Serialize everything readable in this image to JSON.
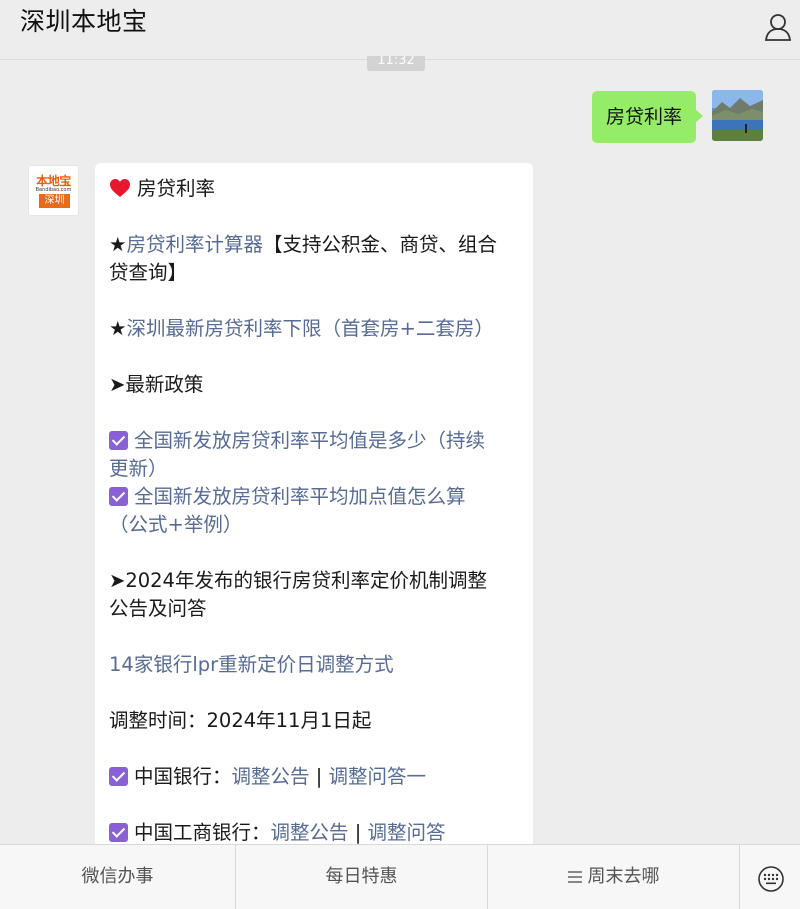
{
  "header": {
    "title": "深圳本地宝"
  },
  "time_label": "11:32",
  "user_message": {
    "text": "房贷利率"
  },
  "bot_avatar": {
    "logo_text": "本地宝",
    "logo_small": "Bendibao.com",
    "logo_box": "深圳"
  },
  "bot_message": {
    "heading": "房贷利率",
    "line1_prefix": "★",
    "line1_link": "房贷利率计算器",
    "line1_suffix": "【支持公积金、商贷、组合",
    "line1_cont": "贷查询】",
    "line2_prefix": "★",
    "line2_link": "深圳最新房贷利率下限（首套房+二套房）",
    "policy_heading": "➤最新政策",
    "item1_line1": "全国新发放房贷利率平均值是多少（持续",
    "item1_line2": "更新）",
    "item2_line1": "全国新发放房贷利率平均加点值怎么算",
    "item2_line2": "（公式+举例）",
    "announce_line1": "➤2024年发布的银行房贷利率定价机制调整",
    "announce_line2": "公告及问答",
    "lpr_link": "14家银行lpr重新定价日调整方式",
    "adjust_time": "调整时间：2024年11月1日起",
    "boc_label": "中国银行：",
    "boc_link1": "调整公告",
    "boc_sep": " | ",
    "boc_link2": "调整问答一",
    "icbc_label": "中国工商银行：",
    "icbc_link1": "调整公告",
    "icbc_sep": " | ",
    "icbc_link2": "调整问答"
  },
  "bottom_menu": {
    "items": [
      "微信办事",
      "每日特惠",
      "周末去哪"
    ]
  },
  "colors": {
    "background": "#ededed",
    "user_bubble": "#95ec69",
    "link": "#576b95",
    "checkbox": "#8a60d6",
    "logo_orange": "#ea6a1c"
  }
}
